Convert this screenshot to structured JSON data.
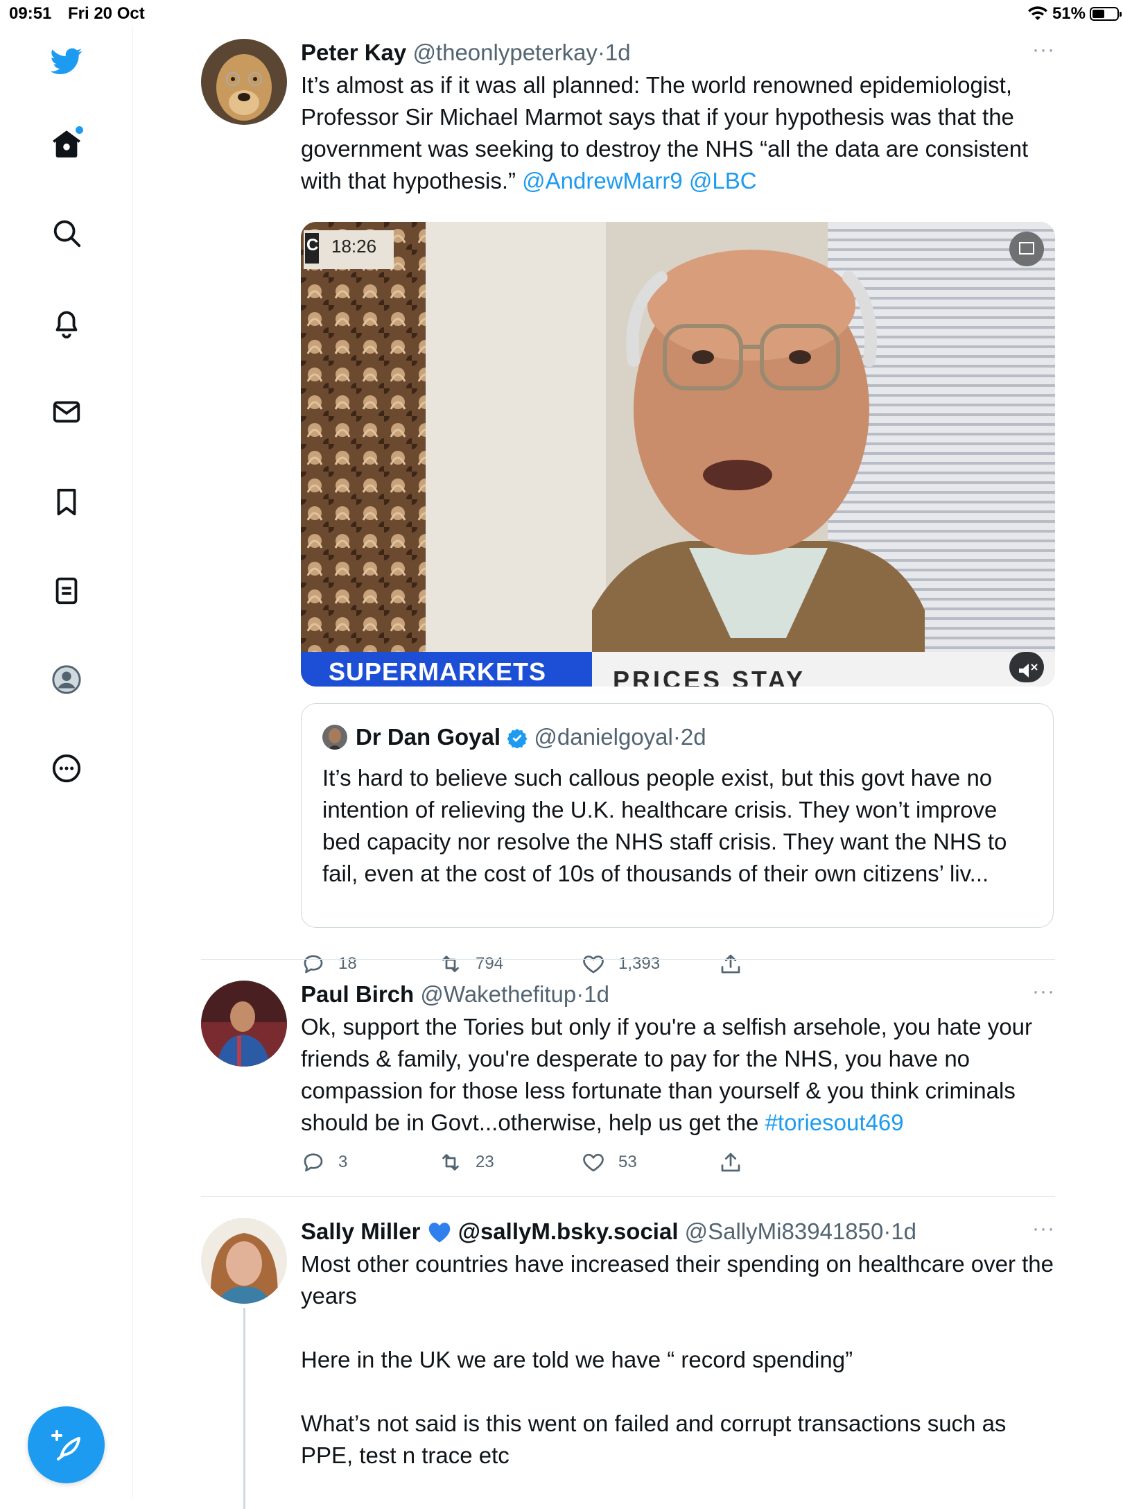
{
  "status_bar": {
    "time": "09:51",
    "date": "Fri 20 Oct",
    "battery_percent": "51%",
    "battery_level": 0.51
  },
  "sidebar": {
    "items": [
      {
        "icon": "twitter-bird-icon"
      },
      {
        "icon": "home-icon"
      },
      {
        "icon": "search-icon"
      },
      {
        "icon": "bell-icon"
      },
      {
        "icon": "mail-icon"
      },
      {
        "icon": "bookmark-icon"
      },
      {
        "icon": "lists-icon"
      },
      {
        "icon": "profile-icon"
      },
      {
        "icon": "more-circle-icon"
      }
    ],
    "compose_icon": "feather-plus-icon"
  },
  "colors": {
    "accent": "#1d9bf0",
    "text": "#0f1419",
    "secondary": "#536471"
  },
  "tweets": [
    {
      "name": "Peter Kay",
      "handle": "@theonlypeterkay",
      "time": "1d",
      "text": "It’s almost as if it was all planned: The world renowned epidemiologist, Professor Sir Michael Marmot says  that if your hypothesis was that the government was seeking to destroy the NHS “all the data are consistent with that hypothesis.” ",
      "mentions": "@AndrewMarr9 @LBC",
      "video": {
        "clock": "18:26",
        "channel_logo": "C",
        "banner_left": "SUPERMARKETS",
        "banner_right": "PRICES STAY"
      },
      "quote": {
        "name": "Dr Dan Goyal",
        "handle": "@danielgoyal",
        "time": "2d",
        "text": "It’s hard to believe such callous people exist, but this govt have no intention of relieving the U.K. healthcare crisis. They won’t improve bed capacity nor resolve the NHS staff crisis. They want the NHS to fail, even at the cost of 10s of thousands of their own citizens’ liv..."
      },
      "replies": "18",
      "retweets": "794",
      "likes": "1,393"
    },
    {
      "name": "Paul Birch",
      "handle": "@Wakethefitup",
      "time": "1d",
      "text": "Ok, support the Tories but only if you're a selfish arsehole, you hate your friends & family, you're desperate to pay for the NHS, you have no compassion for those less fortunate than yourself & you think criminals should be in Govt...otherwise, help us get the ",
      "hashtag": "#toriesout469",
      "replies": "3",
      "retweets": "23",
      "likes": "53"
    },
    {
      "name": "Sally Miller",
      "name_extra": " @sallyM.bsky.social",
      "handle": "@SallyMi83941850",
      "time": "1d",
      "text_1": "Most other countries have increased their spending on healthcare over the years",
      "text_2": "Here in the UK we are told we have “ record spending”",
      "text_3": "What’s not said is this went on failed and corrupt transactions such as PPE, test n trace etc"
    }
  ],
  "separator": "·",
  "more_label": "···"
}
